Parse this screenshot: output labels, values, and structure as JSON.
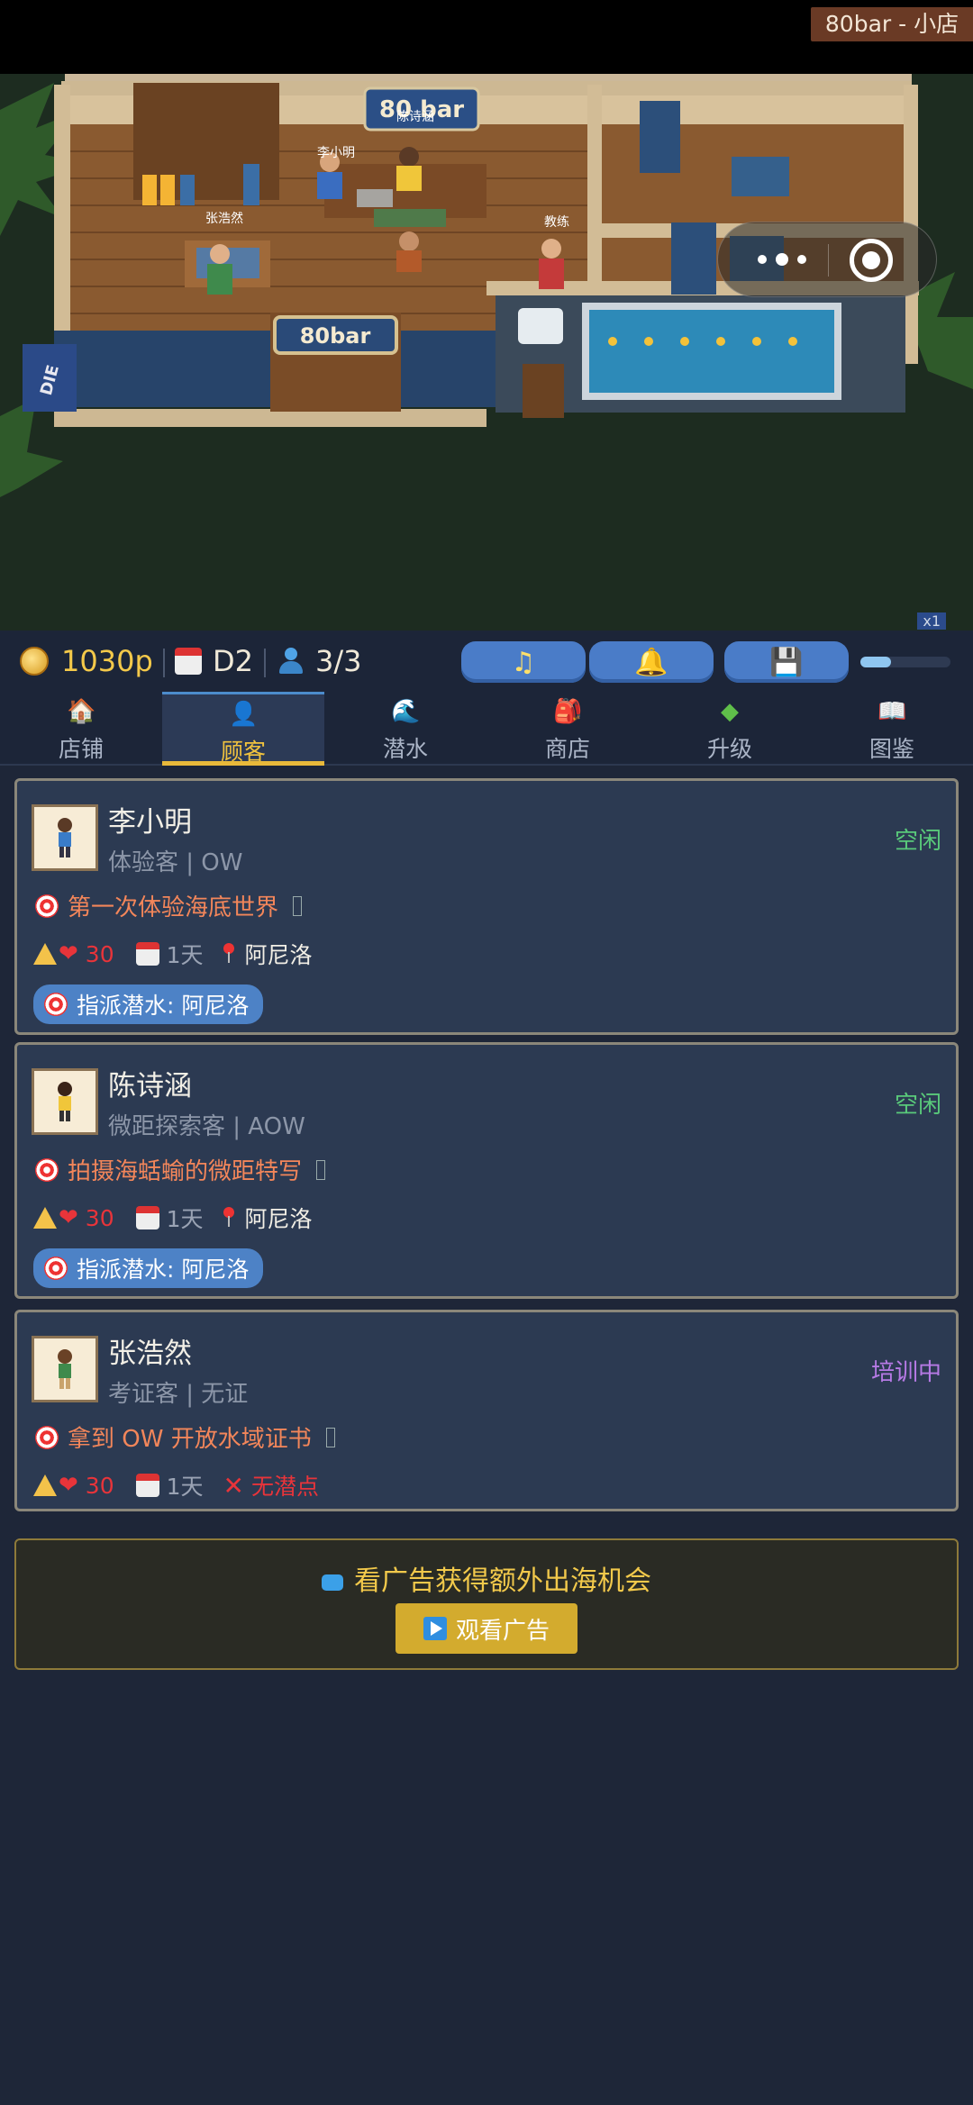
{
  "window": {
    "title": "80bar - 小店"
  },
  "scene": {
    "sign_text": "80bar",
    "wall_sign_text": "80 bar",
    "door_sign_text": "80bar",
    "flag_text": "DIE",
    "speed_label": "x1",
    "labels": [
      {
        "text": "陈诗涵"
      },
      {
        "text": "李小明"
      },
      {
        "text": "张浩然"
      },
      {
        "text": "教练"
      }
    ]
  },
  "status": {
    "coins": "1030p",
    "day": "D2",
    "customers": "3/3",
    "volume_level": 0.34,
    "buttons": [
      {
        "icon": "music-note-icon",
        "glyph": "♫"
      },
      {
        "icon": "bell-icon",
        "glyph": "🔔"
      },
      {
        "icon": "save-disk-icon",
        "glyph": "💾"
      }
    ]
  },
  "tabs": [
    {
      "label": "店铺",
      "icon": "shop-building-icon",
      "glyph": "🏠",
      "active": false
    },
    {
      "label": "顾客",
      "icon": "customer-face-icon",
      "glyph": "👤",
      "active": true
    },
    {
      "label": "潜水",
      "icon": "wave-icon",
      "glyph": "🌊",
      "active": false
    },
    {
      "label": "商店",
      "icon": "backpack-icon",
      "glyph": "🎒",
      "active": false
    },
    {
      "label": "升级",
      "icon": "upgrade-gem-icon",
      "glyph": "◆",
      "active": false
    },
    {
      "label": "图鉴",
      "icon": "book-icon",
      "glyph": "📖",
      "active": false
    }
  ],
  "customers": [
    {
      "name": "李小明",
      "type": "体验客 | OW",
      "status": "空闲",
      "status_color": "#59c97a",
      "goal": "第一次体验海底世界",
      "hp": "30",
      "days": "1天",
      "location": "阿尼洛",
      "assign_label": "指派潜水: 阿尼洛"
    },
    {
      "name": "陈诗涵",
      "type": "微距探索客 | AOW",
      "status": "空闲",
      "status_color": "#59c97a",
      "goal": "拍摄海蛞蝓的微距特写",
      "hp": "30",
      "days": "1天",
      "location": "阿尼洛",
      "assign_label": "指派潜水: 阿尼洛"
    },
    {
      "name": "张浩然",
      "type": "考证客 | 无证",
      "status": "培训中",
      "status_color": "#b77ae6",
      "goal": "拿到 OW 开放水域证书",
      "hp": "30",
      "days": "1天",
      "no_spot": "无潜点"
    }
  ],
  "ad": {
    "text": "看广告获得额外出海机会",
    "button_label": "观看广告"
  }
}
